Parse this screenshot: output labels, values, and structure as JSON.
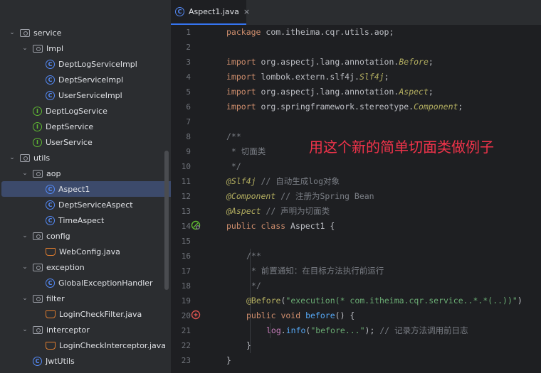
{
  "tab": {
    "filename": "Aspect1.java",
    "close_glyph": "×",
    "icon_letter": "C"
  },
  "tree": [
    {
      "label": "service",
      "icon": "folder",
      "depth": 0,
      "expanded": true
    },
    {
      "label": "Impl",
      "icon": "folder",
      "depth": 1,
      "expanded": true
    },
    {
      "label": "DeptLogServiceImpl",
      "icon": "class",
      "depth": 2
    },
    {
      "label": "DeptServiceImpl",
      "icon": "class",
      "depth": 2
    },
    {
      "label": "UserServiceImpl",
      "icon": "class",
      "depth": 2
    },
    {
      "label": "DeptLogService",
      "icon": "interface",
      "depth": 1
    },
    {
      "label": "DeptService",
      "icon": "interface",
      "depth": 1
    },
    {
      "label": "UserService",
      "icon": "interface",
      "depth": 1
    },
    {
      "label": "utils",
      "icon": "folder",
      "depth": 0,
      "expanded": true
    },
    {
      "label": "aop",
      "icon": "folder",
      "depth": 1,
      "expanded": true
    },
    {
      "label": "Aspect1",
      "icon": "class",
      "depth": 2,
      "selected": true
    },
    {
      "label": "DeptServiceAspect",
      "icon": "class",
      "depth": 2
    },
    {
      "label": "TimeAspect",
      "icon": "class",
      "depth": 2
    },
    {
      "label": "config",
      "icon": "folder",
      "depth": 1,
      "expanded": true
    },
    {
      "label": "WebConfig.java",
      "icon": "java-file",
      "depth": 2
    },
    {
      "label": "exception",
      "icon": "folder",
      "depth": 1,
      "expanded": true
    },
    {
      "label": "GlobalExceptionHandler",
      "icon": "class",
      "depth": 2
    },
    {
      "label": "filter",
      "icon": "folder",
      "depth": 1,
      "expanded": true
    },
    {
      "label": "LoginCheckFilter.java",
      "icon": "java-file",
      "depth": 2
    },
    {
      "label": "interceptor",
      "icon": "folder",
      "depth": 1,
      "expanded": true
    },
    {
      "label": "LoginCheckInterceptor.java",
      "icon": "java-file",
      "depth": 2
    },
    {
      "label": "JwtUtils",
      "icon": "class",
      "depth": 1
    }
  ],
  "line_numbers": [
    "1",
    "2",
    "3",
    "4",
    "5",
    "6",
    "7",
    "8",
    "9",
    "10",
    "11",
    "12",
    "13",
    "14",
    "15",
    "16",
    "17",
    "18",
    "19",
    "20",
    "21",
    "22",
    "23"
  ],
  "code": {
    "l1_kw": "package",
    "l1_rest": " com.itheima.cqr.utils.aop;",
    "l3_kw": "import",
    "l3_pkg": " org.aspectj.lang.annotation.",
    "l3_cls": "Before",
    "l3_end": ";",
    "l4_kw": "import",
    "l4_pkg": " lombok.extern.slf4j.",
    "l4_cls": "Slf4j",
    "l4_end": ";",
    "l5_kw": "import",
    "l5_pkg": " org.aspectj.lang.annotation.",
    "l5_cls": "Aspect",
    "l5_end": ";",
    "l6_kw": "import",
    "l6_pkg": " org.springframework.stereotype.",
    "l6_cls": "Component",
    "l6_end": ";",
    "l8": "/**",
    "l9": " * 切面类",
    "l10": " */",
    "l11_ann": "@Slf4j",
    "l11_cm": " // 自动生成log对象",
    "l12_ann": "@Component",
    "l12_cm": " // 注册为Spring Bean",
    "l13_ann": "@Aspect",
    "l13_cm": " // 声明为切面类",
    "l14_kw": "public class",
    "l14_name": " Aspect1 ",
    "l14_brace": "{",
    "l16": "/**",
    "l17": " * 前置通知：在目标方法执行前运行",
    "l18": " */",
    "l19_ann": "@Before",
    "l19_open": "(",
    "l19_str": "\"execution(* com.itheima.cqr.service..*.*(..))\"",
    "l19_close": ")",
    "l20_kw": "public void",
    "l20_fn": " before",
    "l20_rest": "() {",
    "l21_fld": "log",
    "l21_dot": ".",
    "l21_fn": "info",
    "l21_open": "(",
    "l21_str": "\"before...\"",
    "l21_close": "); ",
    "l21_cm": "// 记录方法调用前日志",
    "l22": "}",
    "l23": "}"
  },
  "overlay_note": "用这个新的简单切面类做例子",
  "colors": {
    "accent": "#3574f0",
    "overlay": "#f0334a",
    "keyword": "#cf8e6d",
    "annotation": "#b3ae60",
    "string": "#6aab73",
    "comment": "#7a7e85"
  }
}
